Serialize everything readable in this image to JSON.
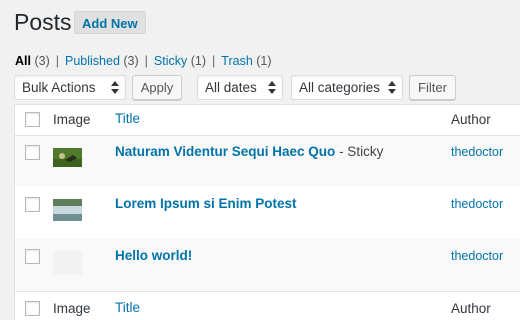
{
  "header": {
    "title": "Posts",
    "add_new": "Add New"
  },
  "filters": {
    "items": [
      {
        "label": "All",
        "count": "(3)",
        "current": true
      },
      {
        "label": "Published",
        "count": "(3)"
      },
      {
        "label": "Sticky",
        "count": "(1)"
      },
      {
        "label": "Trash",
        "count": "(1)"
      }
    ],
    "separator": "|"
  },
  "toolbar": {
    "bulk_actions": "Bulk Actions",
    "apply": "Apply",
    "dates": "All dates",
    "categories": "All categories",
    "filter": "Filter"
  },
  "table": {
    "columns": {
      "image": "Image",
      "title": "Title",
      "author": "Author"
    },
    "rows": [
      {
        "title": "Naturam Videntur Sequi Haec Quo",
        "state": " - Sticky",
        "author": "thedoctor",
        "thumb": "green-field-photo"
      },
      {
        "title": "Lorem Ipsum si Enim Potest",
        "state": "",
        "author": "thedoctor",
        "thumb": "waterfall-photo"
      },
      {
        "title": "Hello world!",
        "state": "",
        "author": "thedoctor",
        "thumb": "blank-placeholder"
      }
    ]
  },
  "colors": {
    "link": "#0073aa",
    "background": "#f1f1f1",
    "alt_row": "#f9f9f9"
  }
}
